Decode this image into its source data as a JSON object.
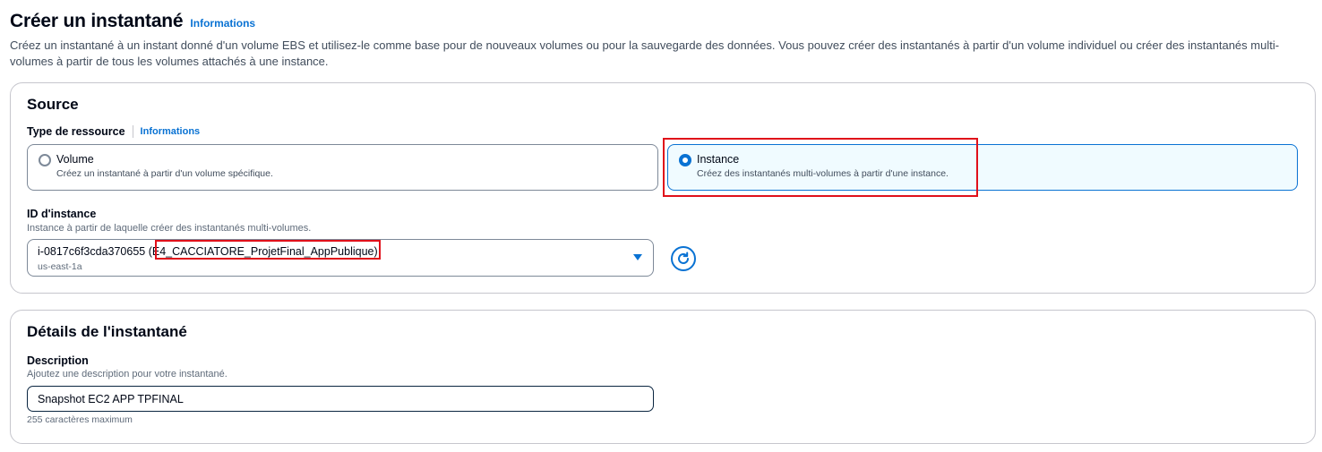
{
  "header": {
    "title": "Créer un instantané",
    "info_link": "Informations",
    "description": "Créez un instantané à un instant donné d'un volume EBS et utilisez-le comme base pour de nouveaux volumes ou pour la sauvegarde des données. Vous pouvez créer des instantanés à partir d'un volume individuel ou créer des instantanés multi-volumes à partir de tous les volumes attachés à une instance."
  },
  "source": {
    "title": "Source",
    "resource_type_label": "Type de ressource",
    "resource_type_info": "Informations",
    "options": [
      {
        "title": "Volume",
        "description": "Créez un instantané à partir d'un volume spécifique.",
        "selected": false
      },
      {
        "title": "Instance",
        "description": "Créez des instantanés multi-volumes à partir d'une instance.",
        "selected": true
      }
    ],
    "instance_id_label": "ID d'instance",
    "instance_id_hint": "Instance à partir de laquelle créer des instantanés multi-volumes.",
    "instance_id_value": "i-0817c6f3cda370655",
    "instance_name": "(E4_CACCIATORE_ProjetFinal_AppPublique)",
    "instance_az": "us-east-1a",
    "refresh_icon": "refresh-icon"
  },
  "details": {
    "title": "Détails de l'instantané",
    "description_label": "Description",
    "description_hint": "Ajoutez une description pour votre instantané.",
    "description_value": "Snapshot EC2 APP TPFINAL",
    "description_constraint": "255 caractères maximum"
  },
  "colors": {
    "accent": "#0972d3",
    "highlight": "#e0101a",
    "text": "#000716",
    "muted": "#5f6b7a",
    "selected_bg": "#f0fbff"
  }
}
